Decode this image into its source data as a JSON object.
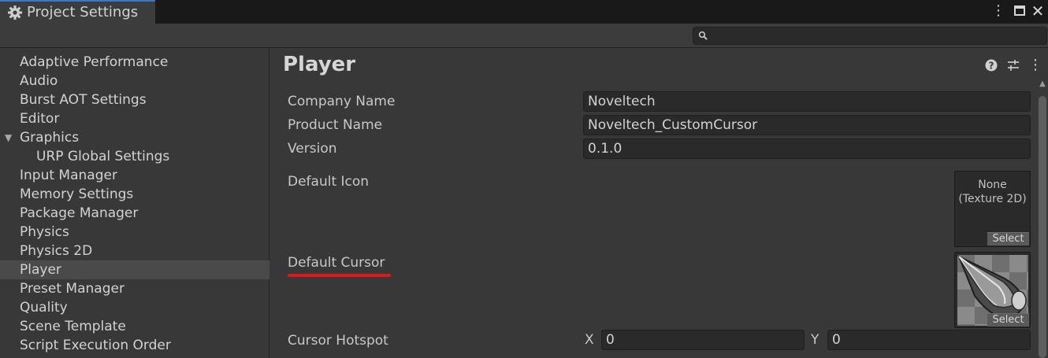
{
  "window": {
    "tab_title": "Project Settings",
    "menu_glyph": "⋮",
    "close_glyph": "✕"
  },
  "search": {
    "placeholder": "",
    "value": ""
  },
  "sidebar": {
    "items": [
      {
        "label": "Adaptive Performance"
      },
      {
        "label": "Audio"
      },
      {
        "label": "Burst AOT Settings"
      },
      {
        "label": "Editor"
      },
      {
        "label": "Graphics",
        "expanded_glyph": "▼"
      },
      {
        "label": "URP Global Settings"
      },
      {
        "label": "Input Manager"
      },
      {
        "label": "Memory Settings"
      },
      {
        "label": "Package Manager"
      },
      {
        "label": "Physics"
      },
      {
        "label": "Physics 2D"
      },
      {
        "label": "Player",
        "selected": true
      },
      {
        "label": "Preset Manager"
      },
      {
        "label": "Quality"
      },
      {
        "label": "Scene Template"
      },
      {
        "label": "Script Execution Order"
      }
    ]
  },
  "main": {
    "title": "Player",
    "menu_glyph": "⋮",
    "company_name_label": "Company Name",
    "company_name_value": "Noveltech",
    "product_name_label": "Product Name",
    "product_name_value": "Noveltech_CustomCursor",
    "version_label": "Version",
    "version_value": "0.1.0",
    "default_icon_label": "Default Icon",
    "default_icon_none_line1": "None",
    "default_icon_none_line2": "(Texture 2D)",
    "select_label": "Select",
    "default_cursor_label": "Default Cursor",
    "cursor_hotspot_label": "Cursor Hotspot",
    "hotspot_x_label": "X",
    "hotspot_x_value": "0",
    "hotspot_y_label": "Y",
    "hotspot_y_value": "0"
  },
  "colors": {
    "background": "#383838",
    "titlebar": "#191919",
    "field": "#2a2a2a",
    "highlight_underline": "#e0181e",
    "selected_row": "#4a4a4a",
    "tab_accent": "#3a79bb"
  }
}
